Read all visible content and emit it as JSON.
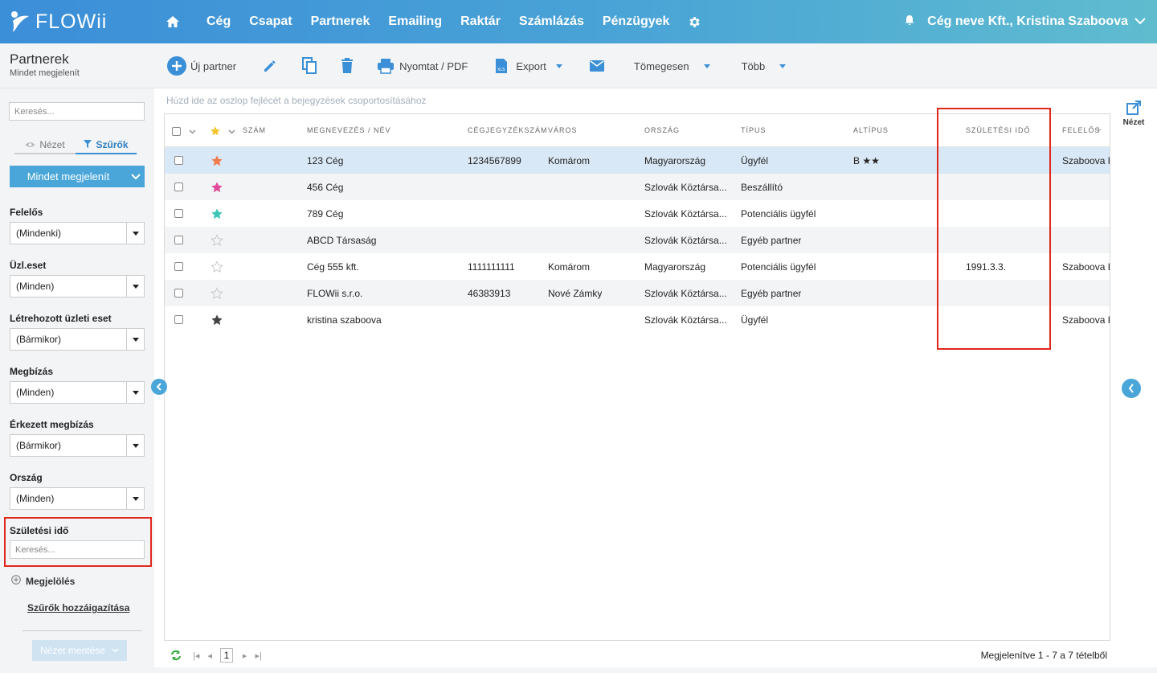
{
  "app": {
    "logo_text": "FLOWii"
  },
  "nav": {
    "items": [
      "Cég",
      "Csapat",
      "Partnerek",
      "Emailing",
      "Raktár",
      "Számlázás",
      "Pénzügyek"
    ],
    "user": "Cég neve Kft., Kristina Szaboova"
  },
  "page": {
    "title": "Partnerek",
    "subtitle": "Mindet megjelenít"
  },
  "toolbar": {
    "new_partner": "Új partner",
    "print": "Nyomtat / PDF",
    "export": "Export",
    "bulk": "Tömegesen",
    "more": "Több"
  },
  "sidebar": {
    "search_placeholder": "Keresés...",
    "tab_view": "Nézet",
    "tab_filters": "Szűrők",
    "show_all": "Mindet megjelenít",
    "filters": [
      {
        "label": "Felelős",
        "value": "(Mindenki)"
      },
      {
        "label": "Üzl.eset",
        "value": "(Minden)"
      },
      {
        "label": "Létrehozott üzleti eset",
        "value": "(Bármikor)"
      },
      {
        "label": "Megbízás",
        "value": "(Minden)"
      },
      {
        "label": "Érkezett megbízás",
        "value": "(Bármikor)"
      },
      {
        "label": "Ország",
        "value": "(Minden)"
      }
    ],
    "birth_label": "Születési idő",
    "birth_placeholder": "Keresés...",
    "mark": "Megjelölés",
    "assign_filters": "Szűrők hozzáigazítása",
    "save_view": "Nézet mentése"
  },
  "grid": {
    "group_hint": "Húzd ide az oszlop fejlécét a bejegyzések csoportosításához",
    "columns": [
      "SZÁM",
      "MEGNEVEZÉS / NÉV",
      "CÉGJEGYZÉKSZÁM",
      "VÁROS",
      "ORSZÁG",
      "TÍPUS",
      "ALTÍPUS",
      "SZÜLETÉSI IDŐ",
      "FELELŐS"
    ],
    "rows": [
      {
        "star": "#f07b4f",
        "name": "123 Cég",
        "reg": "1234567899",
        "city": "Komárom",
        "country": "Magyarország",
        "type": "Ügyfél",
        "subtype": "B ★★",
        "birth": "",
        "owner": "Szaboova K"
      },
      {
        "star": "#e04a9a",
        "name": "456 Cég",
        "reg": "",
        "city": "",
        "country": "Szlovák Köztársa...",
        "type": "Beszállító",
        "subtype": "",
        "birth": "",
        "owner": ""
      },
      {
        "star": "#3cc6b8",
        "name": "789 Cég",
        "reg": "",
        "city": "",
        "country": "Szlovák Köztársa...",
        "type": "Potenciális ügyfél",
        "subtype": "",
        "birth": "",
        "owner": ""
      },
      {
        "star": "",
        "name": "ABCD Társaság",
        "reg": "",
        "city": "",
        "country": "Szlovák Köztársa...",
        "type": "Egyéb partner",
        "subtype": "",
        "birth": "",
        "owner": ""
      },
      {
        "star": "",
        "name": "Cég 555 kft.",
        "reg": "1111111111",
        "city": "Komárom",
        "country": "Magyarország",
        "type": "Potenciális ügyfél",
        "subtype": "",
        "birth": "1991.3.3.",
        "owner": "Szaboova K"
      },
      {
        "star": "",
        "name": "FLOWii s.r.o.",
        "reg": "46383913",
        "city": "Nové Zámky",
        "country": "Szlovák Köztársa...",
        "type": "Egyéb partner",
        "subtype": "",
        "birth": "",
        "owner": ""
      },
      {
        "star": "#444444",
        "name": "kristina szaboova",
        "reg": "",
        "city": "",
        "country": "Szlovák Köztársa...",
        "type": "Ügyfél",
        "subtype": "",
        "birth": "",
        "owner": "Szaboova K"
      }
    ]
  },
  "pager": {
    "page": "1",
    "summary": "Megjelenítve 1 - 7 a 7 tételből"
  },
  "right_rail": {
    "view_label": "Nézet"
  },
  "colors": {
    "accent": "#3a8fd6",
    "highlight": "#e0271c",
    "header_start": "#3b8ed8",
    "header_end": "#5fbccf"
  }
}
